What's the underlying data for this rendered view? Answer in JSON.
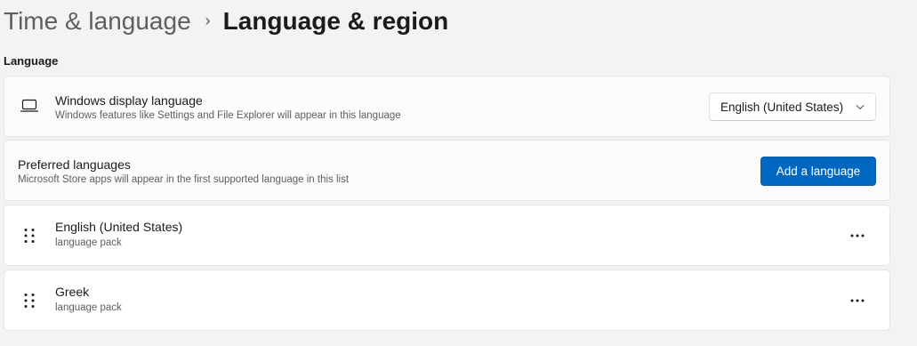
{
  "header": {
    "parent": "Time & language",
    "separator": "›",
    "current": "Language & region"
  },
  "section": {
    "label": "Language"
  },
  "display_language": {
    "title": "Windows display language",
    "subtitle": "Windows features like Settings and File Explorer will appear in this language",
    "selected": "English (United States)",
    "icon": "laptop-icon"
  },
  "preferred_languages": {
    "title": "Preferred languages",
    "subtitle": "Microsoft Store apps will appear in the first supported language in this list",
    "add_button": "Add a language"
  },
  "languages": [
    {
      "name": "English (United States)",
      "detail": "language pack"
    },
    {
      "name": "Greek",
      "detail": "language pack"
    }
  ],
  "colors": {
    "accent": "#0067c0",
    "background": "#f3f3f3",
    "card": "#fbfbfb"
  }
}
